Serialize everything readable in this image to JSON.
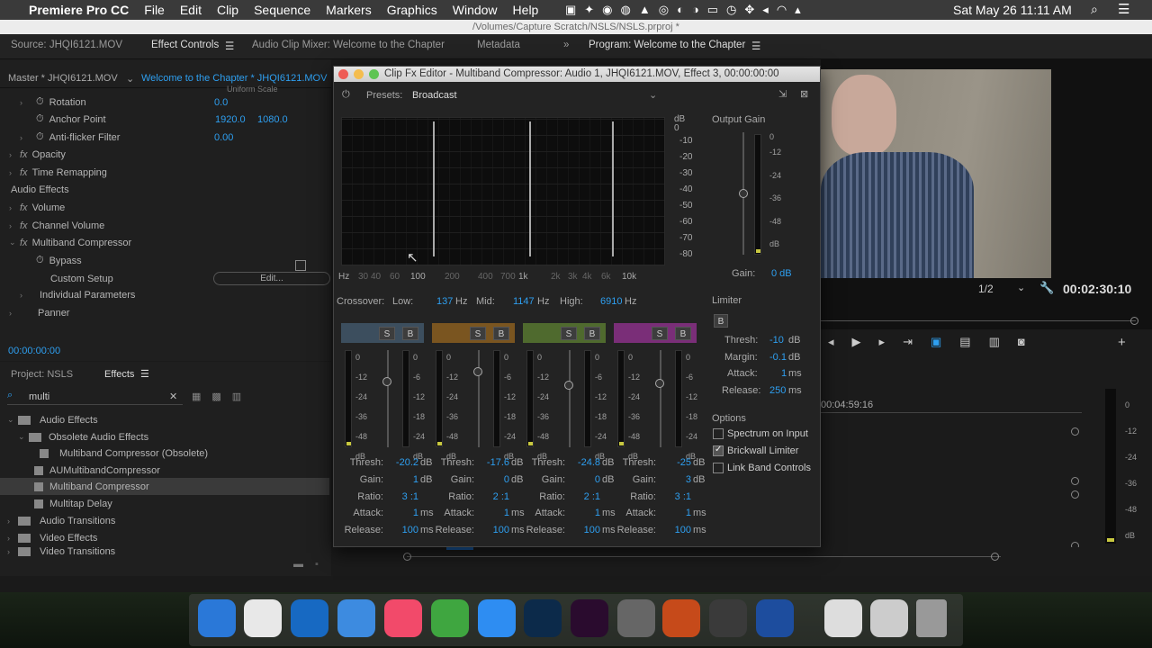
{
  "menubar": {
    "apple": "",
    "app": "Premiere Pro CC",
    "items": [
      "File",
      "Edit",
      "Clip",
      "Sequence",
      "Markers",
      "Graphics",
      "Window",
      "Help"
    ],
    "clock": "Sat May 26  11:11 AM"
  },
  "path": "/Volumes/Capture Scratch/NSLS/NSLS.prproj *",
  "tabs": {
    "source": "Source: JHQI6121.MOV",
    "effect_controls": "Effect Controls",
    "mixer": "Audio Clip Mixer: Welcome to the Chapter",
    "metadata": "Metadata",
    "program": "Program: Welcome to the Chapter"
  },
  "ec": {
    "master": "Master * JHQI6121.MOV",
    "seq": "Welcome to the Chapter * JHQI6121.MOV",
    "uniform": "Uniform Scale",
    "rotation": "Rotation",
    "rotation_val": "0.0",
    "anchor": "Anchor Point",
    "anchor_x": "1920.0",
    "anchor_y": "1080.0",
    "antiflicker": "Anti-flicker Filter",
    "antiflicker_val": "0.00",
    "opacity": "Opacity",
    "time_remap": "Time Remapping",
    "audio_effects": "Audio Effects",
    "volume": "Volume",
    "channel_volume": "Channel Volume",
    "multiband": "Multiband Compressor",
    "bypass": "Bypass",
    "custom_setup": "Custom Setup",
    "edit_btn": "Edit...",
    "individual": "Individual Parameters",
    "panner": "Panner",
    "timecode": "00:00:00:00"
  },
  "effects_panel": {
    "project": "Project: NSLS",
    "effects": "Effects",
    "search": "multi",
    "items": [
      "Audio Effects",
      "Obsolete Audio Effects",
      "Multiband Compressor (Obsolete)",
      "AUMultibandCompressor",
      "Multiband Compressor",
      "Multitap Delay",
      "Audio Transitions",
      "Video Effects",
      "Video Transitions"
    ]
  },
  "dialog": {
    "title": "Clip Fx Editor - Multiband Compressor: Audio 1, JHQI6121.MOV, Effect 3, 00:00:00:00",
    "presets_label": "Presets:",
    "preset": "Broadcast",
    "db_scale": [
      "dB",
      "0",
      "-10",
      "-20",
      "-30",
      "-40",
      "-50",
      "-60",
      "-70",
      "-80"
    ],
    "hz_scale": [
      "Hz",
      "30",
      "40",
      "60",
      "100",
      "200",
      "400",
      "700",
      "1k",
      "2k",
      "3k",
      "4k",
      "6k",
      "10k"
    ],
    "crossover": {
      "label": "Crossover:",
      "low_label": "Low:",
      "low": "137",
      "mid_label": "Mid:",
      "mid": "1147",
      "high_label": "High:",
      "high": "6910",
      "unit": "Hz"
    },
    "output_gain": {
      "label": "Output Gain",
      "scale": [
        "0",
        "-12",
        "-24",
        "-36",
        "-48",
        "dB"
      ],
      "gain_label": "Gain:",
      "gain": "0 dB"
    },
    "bands": [
      {
        "color": "#3c4e5e",
        "thresh": "-20.2",
        "gain": "1",
        "ratio": "3 :1",
        "attack": "1",
        "release": "100"
      },
      {
        "color": "#7a5520",
        "thresh": "-17.6",
        "gain": "0",
        "ratio": "2 :1",
        "attack": "1",
        "release": "100"
      },
      {
        "color": "#4f6a2e",
        "thresh": "-24.8",
        "gain": "0",
        "ratio": "2 :1",
        "attack": "1",
        "release": "100"
      },
      {
        "color": "#7a2e78",
        "thresh": "-25",
        "gain": "3",
        "ratio": "3 :1",
        "attack": "1",
        "release": "100"
      }
    ],
    "band_labels": {
      "s": "S",
      "b": "B",
      "thresh": "Thresh:",
      "gain": "Gain:",
      "ratio": "Ratio:",
      "attack": "Attack:",
      "release": "Release:",
      "db": "dB",
      "ms": "ms"
    },
    "band_scale_l": [
      "0",
      "-12",
      "-24",
      "-36",
      "-48",
      "dB"
    ],
    "band_scale_r": [
      "0",
      "-6",
      "-12",
      "-18",
      "-24",
      "dB"
    ],
    "limiter": {
      "label": "Limiter",
      "b": "B",
      "thresh_label": "Thresh:",
      "thresh": "-10",
      "margin_label": "Margin:",
      "margin": "-0.1",
      "attack_label": "Attack:",
      "attack": "1",
      "release_label": "Release:",
      "release": "250"
    },
    "options": {
      "label": "Options",
      "spectrum": "Spectrum on Input",
      "brickwall": "Brickwall Limiter",
      "link": "Link Band Controls"
    }
  },
  "program": {
    "fraction": "1/2",
    "timecode": "00:02:30:10",
    "seq_time": "00:04:59:16"
  },
  "dock_colors": [
    "#2a78d8",
    "#e8e8e8",
    "#1769c2",
    "#3d8be0",
    "#f24a6a",
    "#3fa640",
    "#2e8df2",
    "#0c2a4a",
    "#2a0b2e",
    "#666",
    "#c64a1a",
    "#3a3a3a",
    "#1d4d9e",
    "#ddd",
    "#ccc",
    "#999"
  ]
}
